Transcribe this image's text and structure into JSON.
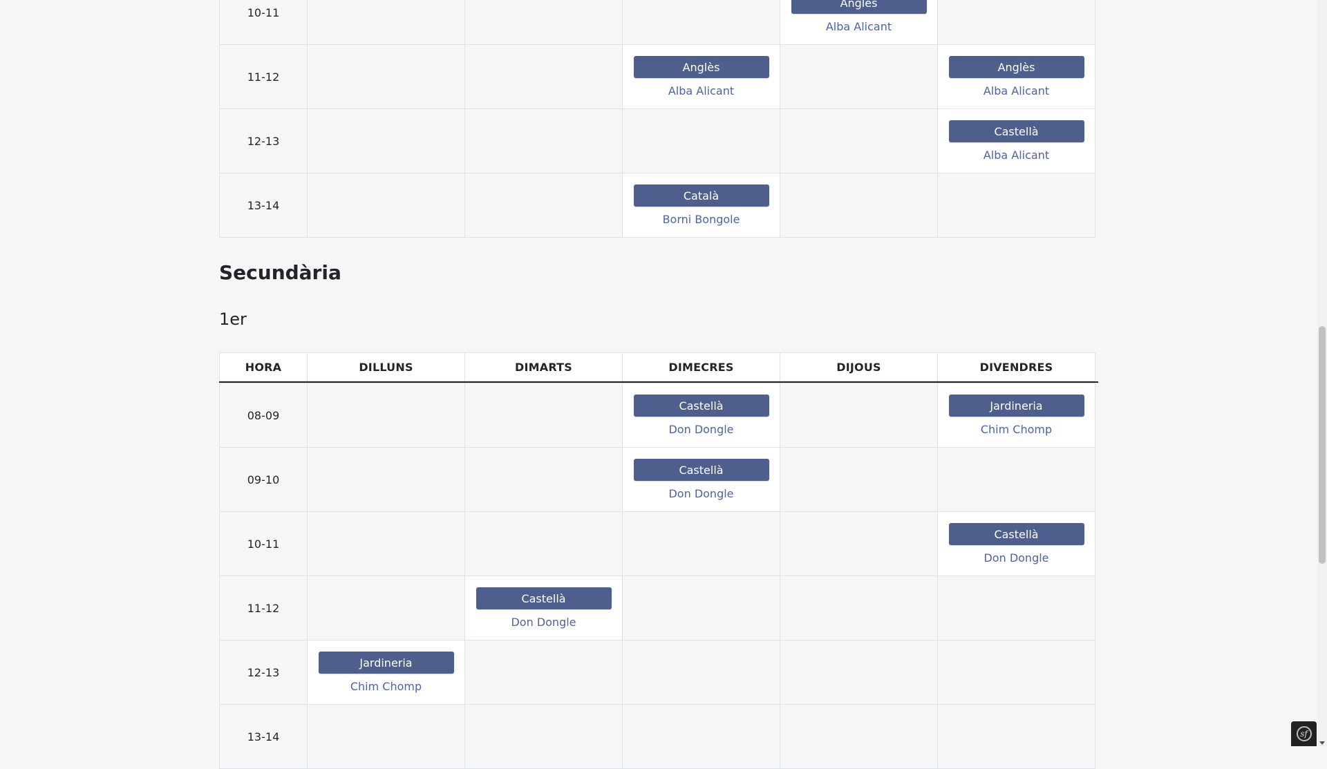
{
  "primary_table": {
    "rows": [
      {
        "hour": "10-11",
        "cells": [
          null,
          null,
          null,
          {
            "subject": "Anglès",
            "teacher": "Alba Alicant"
          },
          null
        ]
      },
      {
        "hour": "11-12",
        "cells": [
          null,
          null,
          {
            "subject": "Anglès",
            "teacher": "Alba Alicant"
          },
          null,
          {
            "subject": "Anglès",
            "teacher": "Alba Alicant"
          }
        ]
      },
      {
        "hour": "12-13",
        "cells": [
          null,
          null,
          null,
          null,
          {
            "subject": "Castellà",
            "teacher": "Alba Alicant"
          }
        ]
      },
      {
        "hour": "13-14",
        "cells": [
          null,
          null,
          {
            "subject": "Català",
            "teacher": "Borni Bongole"
          },
          null,
          null
        ]
      }
    ]
  },
  "section_title": "Secundària",
  "year_title": "1er",
  "secondary_table": {
    "headers": [
      "HORA",
      "DILLUNS",
      "DIMARTS",
      "DIMECRES",
      "DIJOUS",
      "DIVENDRES"
    ],
    "rows": [
      {
        "hour": "08-09",
        "cells": [
          null,
          null,
          {
            "subject": "Castellà",
            "teacher": "Don Dongle"
          },
          null,
          {
            "subject": "Jardineria",
            "teacher": "Chim Chomp"
          }
        ]
      },
      {
        "hour": "09-10",
        "cells": [
          null,
          null,
          {
            "subject": "Castellà",
            "teacher": "Don Dongle"
          },
          null,
          null
        ]
      },
      {
        "hour": "10-11",
        "cells": [
          null,
          null,
          null,
          null,
          {
            "subject": "Castellà",
            "teacher": "Don Dongle"
          }
        ]
      },
      {
        "hour": "11-12",
        "cells": [
          null,
          {
            "subject": "Castellà",
            "teacher": "Don Dongle"
          },
          null,
          null,
          null
        ]
      },
      {
        "hour": "12-13",
        "cells": [
          {
            "subject": "Jardineria",
            "teacher": "Chim Chomp"
          },
          null,
          null,
          null,
          null
        ]
      },
      {
        "hour": "13-14",
        "cells": [
          null,
          null,
          null,
          null,
          null
        ]
      }
    ]
  },
  "colors": {
    "subject_bg": "#4e5f8d",
    "teacher_text": "#4e63a0",
    "page_bg": "#f5f6f8"
  },
  "icons": {
    "toolbar": "symfony-logo-icon"
  }
}
